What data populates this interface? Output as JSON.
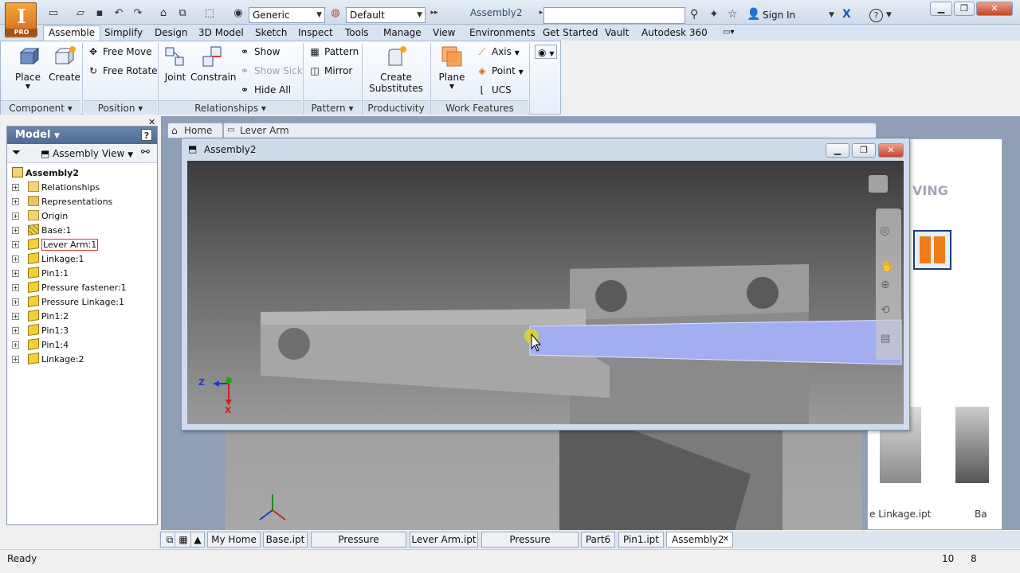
{
  "app": {
    "logo_letter": "I",
    "logo_pro": "PRO",
    "doc_title": "Assembly2",
    "material_combo": "Generic",
    "appearance_combo": "Default",
    "sign_in": "Sign In"
  },
  "ribbon_tabs": [
    "Assemble",
    "Simplify",
    "Design",
    "3D Model",
    "Sketch",
    "Inspect",
    "Tools",
    "Manage",
    "View",
    "Environments",
    "Get Started",
    "Vault",
    "Autodesk 360"
  ],
  "ribbon": {
    "component": {
      "place": "Place",
      "create": "Create",
      "label": "Component"
    },
    "position": {
      "free_move": "Free Move",
      "free_rotate": "Free Rotate",
      "label": "Position"
    },
    "relationships": {
      "joint": "Joint",
      "constrain": "Constrain",
      "show": "Show",
      "show_sick": "Show Sick",
      "hide_all": "Hide All",
      "label": "Relationships"
    },
    "pattern": {
      "pattern": "Pattern",
      "mirror": "Mirror",
      "label": "Pattern"
    },
    "productivity": {
      "create_line1": "Create",
      "create_line2": "Substitutes",
      "label": "Productivity"
    },
    "work_features": {
      "plane": "Plane",
      "axis": "Axis",
      "point": "Point",
      "ucs": "UCS",
      "label": "Work Features"
    }
  },
  "browser": {
    "title": "Model",
    "help": "?",
    "view": "Assembly View",
    "root": "Assembly2",
    "items": [
      {
        "label": "Relationships",
        "kind": "folder"
      },
      {
        "label": "Representations",
        "kind": "rep"
      },
      {
        "label": "Origin",
        "kind": "folder"
      },
      {
        "label": "Base:1",
        "kind": "grounded"
      },
      {
        "label": "Lever Arm:1",
        "kind": "part-selected"
      },
      {
        "label": "Linkage:1",
        "kind": "part"
      },
      {
        "label": "Pin1:1",
        "kind": "part"
      },
      {
        "label": "Pressure fastener:1",
        "kind": "part"
      },
      {
        "label": "Pressure Linkage:1",
        "kind": "part"
      },
      {
        "label": "Pin1:2",
        "kind": "part"
      },
      {
        "label": "Pin1:3",
        "kind": "part"
      },
      {
        "label": "Pin1:4",
        "kind": "part"
      },
      {
        "label": "Linkage:2",
        "kind": "part"
      }
    ]
  },
  "workspace": {
    "home_tab": "Home",
    "lever_tab": "Lever Arm",
    "home_panel_text": "VING",
    "home_panel_labels": [
      "e Linkage.ipt",
      "Ba"
    ]
  },
  "assembly_window": {
    "title": "Assembly2",
    "axis_z": "Z",
    "axis_x": "X"
  },
  "doc_tabs": [
    "My Home",
    "Base.ipt",
    "Pressure Linkage.ipt",
    "Lever Arm.ipt",
    "Pressure fastener.ipt",
    "Part6",
    "Pin1.ipt",
    "Assembly2"
  ],
  "status": {
    "text": "Ready",
    "count1": "10",
    "count2": "8"
  },
  "colors": {
    "accent": "#f07d1c",
    "highlight": "#a3aef0",
    "ribbon_tab_bg": "#d7e3f1"
  }
}
